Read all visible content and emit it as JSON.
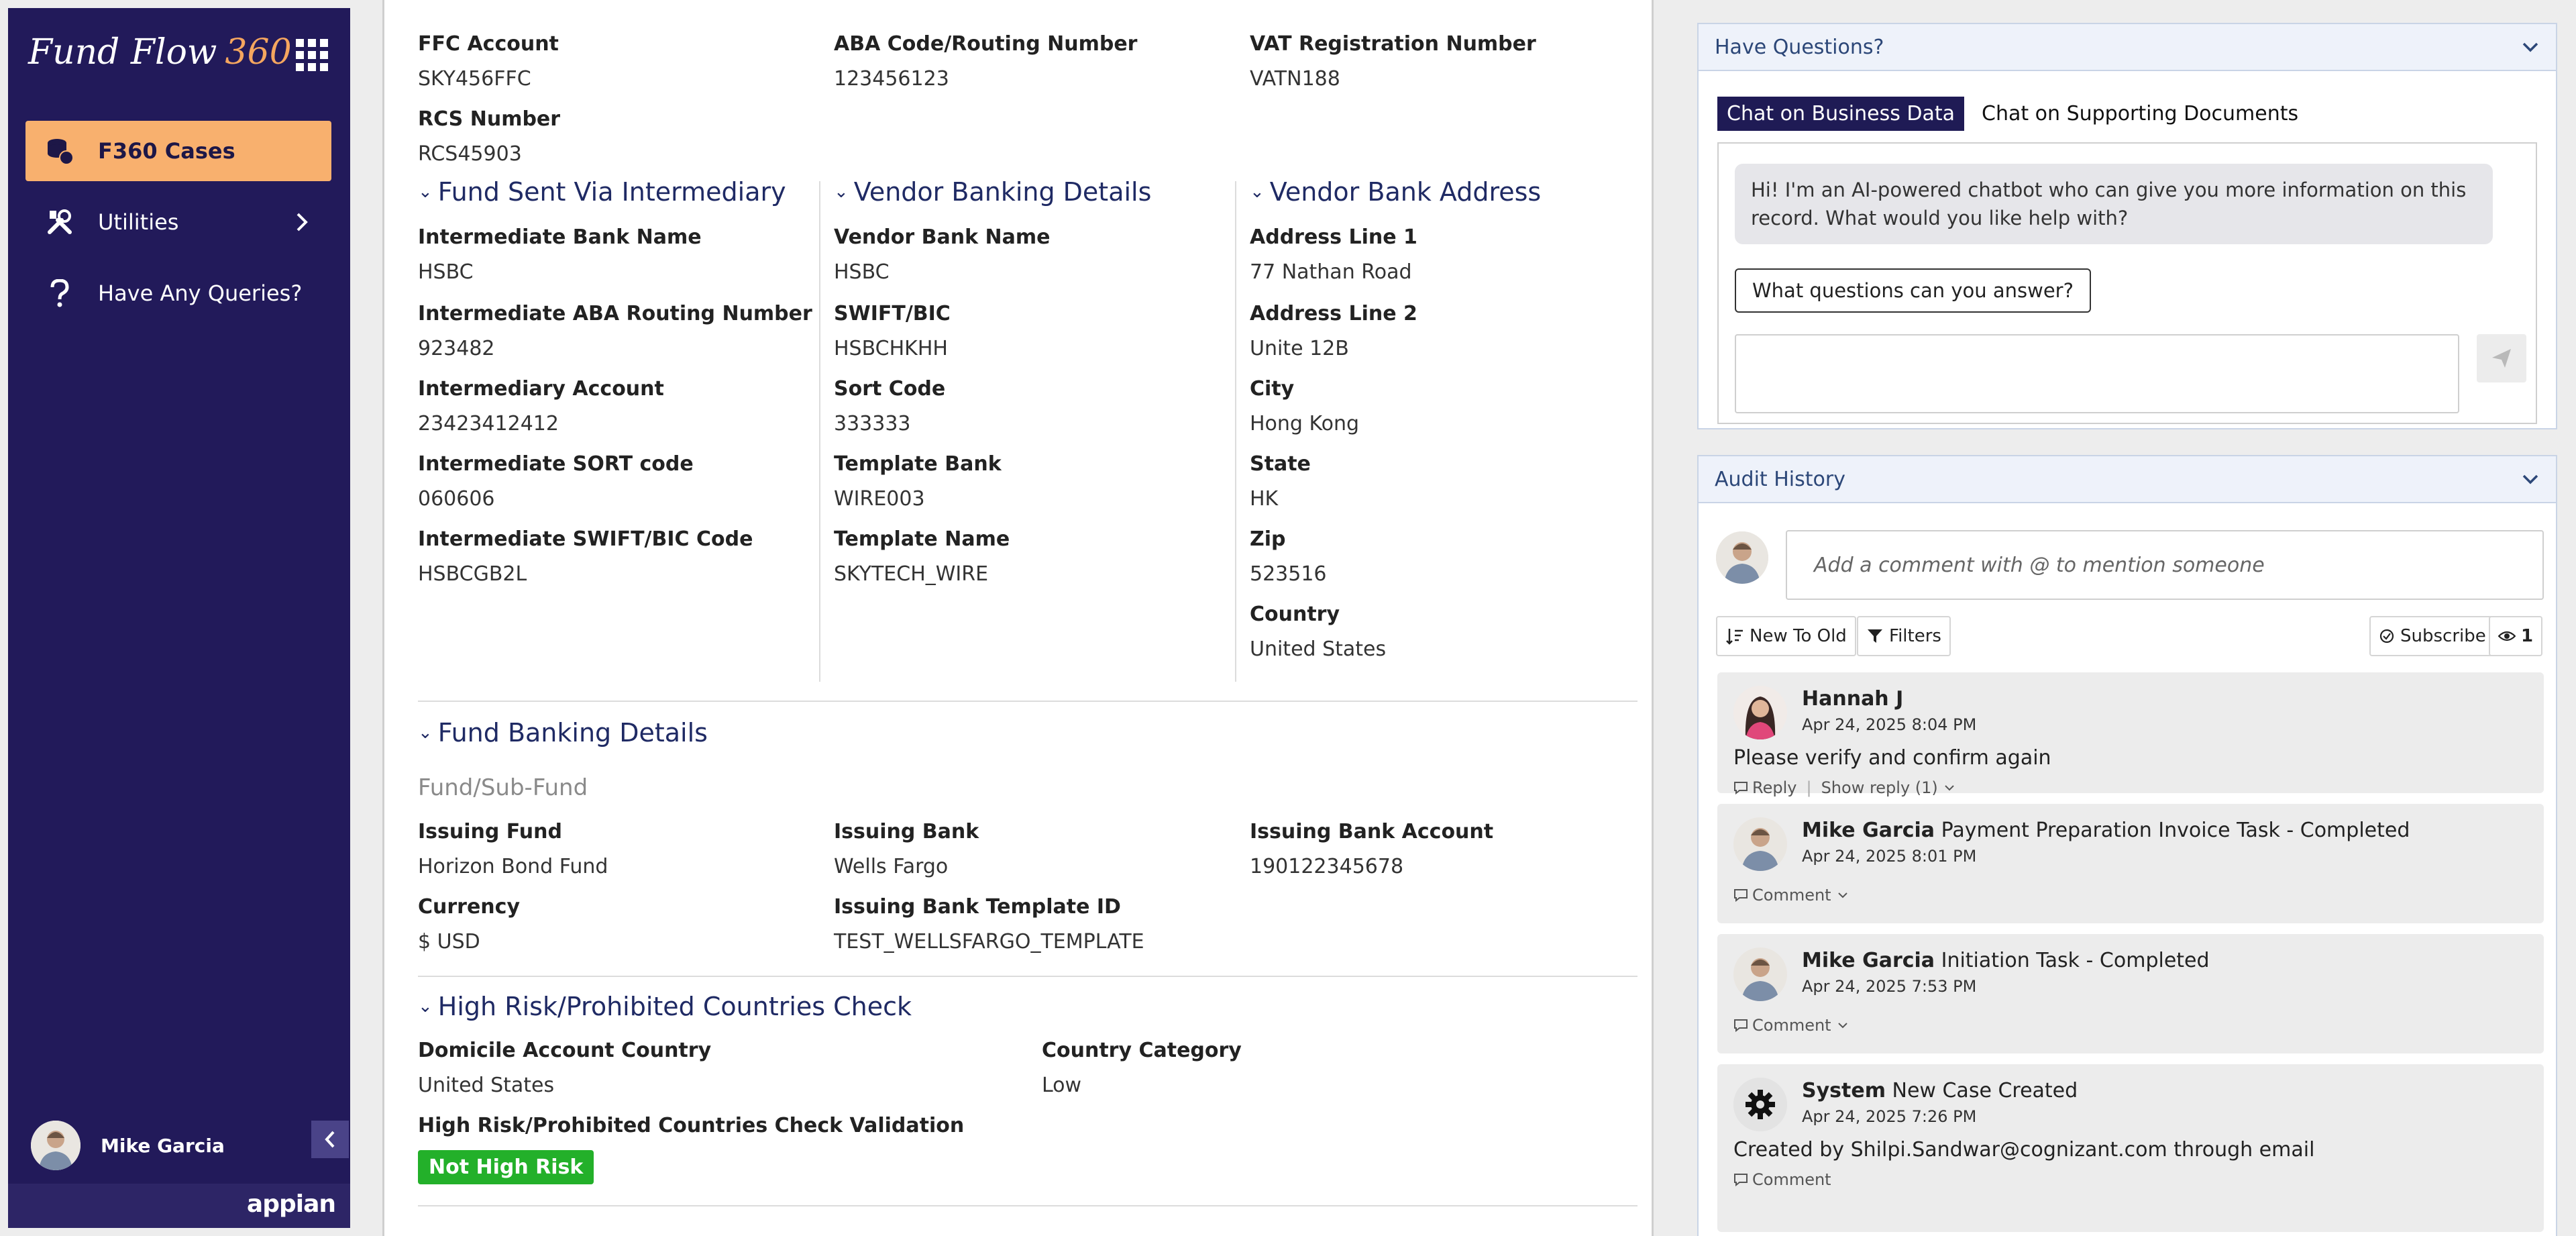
{
  "sidebar": {
    "brand_name": "Fund Flow",
    "brand_number": "360",
    "items": [
      {
        "label": "F360 Cases",
        "icon": "coins-icon",
        "active": true
      },
      {
        "label": "Utilities",
        "icon": "tools-icon"
      },
      {
        "label": "Have Any Queries?",
        "icon": "question-icon"
      }
    ],
    "user_name": "Mike Garcia",
    "footer_logo": "appian"
  },
  "main": {
    "top_fields": [
      {
        "label": "FFC Account",
        "value": "SKY456FFC"
      },
      {
        "label": "ABA Code/Routing Number",
        "value": "123456123"
      },
      {
        "label": "VAT Registration Number",
        "value": "VATN188"
      },
      {
        "label": "RCS Number",
        "value": "RCS45903"
      }
    ],
    "intermediary": {
      "title": "Fund Sent Via Intermediary",
      "fields": [
        {
          "label": "Intermediate Bank Name",
          "value": "HSBC"
        },
        {
          "label": "Intermediate ABA Routing Number",
          "value": "923482"
        },
        {
          "label": "Intermediary Account",
          "value": "23423412412"
        },
        {
          "label": "Intermediate SORT code",
          "value": "060606"
        },
        {
          "label": "Intermediate SWIFT/BIC Code",
          "value": "HSBCGB2L"
        }
      ]
    },
    "vendor_banking": {
      "title": "Vendor Banking Details",
      "fields": [
        {
          "label": "Vendor Bank Name",
          "value": "HSBC"
        },
        {
          "label": "SWIFT/BIC",
          "value": "HSBCHKHH"
        },
        {
          "label": "Sort Code",
          "value": "333333"
        },
        {
          "label": "Template Bank",
          "value": "WIRE003"
        },
        {
          "label": "Template Name",
          "value": "SKYTECH_WIRE"
        }
      ]
    },
    "vendor_address": {
      "title": "Vendor Bank Address",
      "fields": [
        {
          "label": "Address Line 1",
          "value": "77 Nathan Road"
        },
        {
          "label": "Address Line 2",
          "value": "Unite 12B"
        },
        {
          "label": "City",
          "value": "Hong Kong"
        },
        {
          "label": "State",
          "value": "HK"
        },
        {
          "label": "Zip",
          "value": "523516"
        },
        {
          "label": "Country",
          "value": "United States"
        }
      ]
    },
    "fund_banking": {
      "title": "Fund Banking Details",
      "subhead": "Fund/Sub-Fund",
      "issuing_fund_label": "Issuing Fund",
      "issuing_fund": "Horizon Bond Fund",
      "issuing_bank_label": "Issuing Bank",
      "issuing_bank": "Wells Fargo",
      "issuing_account_label": "Issuing Bank Account",
      "issuing_account": "190122345678",
      "currency_label": "Currency",
      "currency_symbol": "$",
      "currency": "USD",
      "template_label": "Issuing Bank Template ID",
      "template": "TEST_WELLSFARGO_TEMPLATE"
    },
    "risk": {
      "title": "High Risk/Prohibited Countries Check",
      "domicile_label": "Domicile Account Country",
      "domicile": "United States",
      "category_label": "Country Category",
      "category": "Low",
      "validation_label": "High Risk/Prohibited Countries Check Validation",
      "validation_badge": "Not High Risk",
      "badge_color": "#23b02a"
    }
  },
  "chat": {
    "title": "Have Questions?",
    "tab_active": "Chat on Business Data",
    "tab_other": "Chat on Supporting Documents",
    "bot_message": "Hi! I'm an AI-powered chatbot who can give you more information on this record. What would you like help with?",
    "suggestion": "What questions can you answer?"
  },
  "audit": {
    "title": "Audit History",
    "comment_placeholder": "Add a comment with @ to mention someone",
    "sort_label": "New To Old",
    "filters_label": "Filters",
    "subscribe_label": "Subscribe",
    "watchers": "1",
    "entries": [
      {
        "name": "Hannah J",
        "action": "",
        "date": "Apr 24, 2025 8:04 PM",
        "text": "Please verify and confirm again",
        "reply": "Reply",
        "show_reply": "Show reply (1)"
      },
      {
        "name": "Mike Garcia",
        "action": "Payment Preparation Invoice Task - Completed",
        "date": "Apr 24, 2025 8:01 PM",
        "comment": "Comment"
      },
      {
        "name": "Mike Garcia",
        "action": "Initiation Task - Completed",
        "date": "Apr 24, 2025 7:53 PM",
        "comment": "Comment"
      },
      {
        "name": "System",
        "action": "New Case Created",
        "date": "Apr 24, 2025 7:26 PM",
        "text": "Created by Shilpi.Sandwar@cognizant.com through email",
        "comment": "Comment"
      }
    ]
  }
}
